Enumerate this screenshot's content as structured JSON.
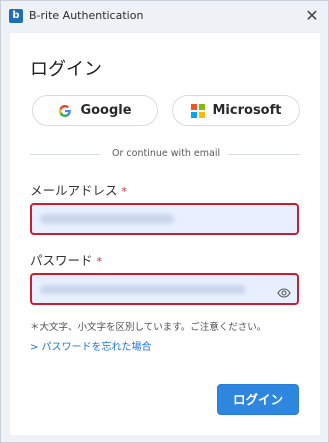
{
  "window": {
    "title": "B-rite Authentication",
    "app_icon_text": "b",
    "close_glyph": "✕"
  },
  "login": {
    "heading": "ログイン",
    "google_label": "Google",
    "microsoft_label": "Microsoft",
    "divider_text": "Or continue with email",
    "email_label": "メールアドレス",
    "email_required": "*",
    "email_value": "",
    "password_label": "パスワード",
    "password_required": "*",
    "password_value": "",
    "hint": "＊大文字、小文字を区別しています。ご注意ください。",
    "forgot_link": "> パスワードを忘れた場合",
    "submit_label": "ログイン"
  },
  "icons": {
    "app": "app-logo-icon",
    "close": "close-icon",
    "google": "google-icon",
    "microsoft": "microsoft-icon",
    "eye": "eye-icon"
  },
  "colors": {
    "accent": "#2f86de",
    "error_border": "#c81e32",
    "input_fill": "#e8f0ff",
    "link": "#1a73e8",
    "required": "#d32f2f"
  }
}
